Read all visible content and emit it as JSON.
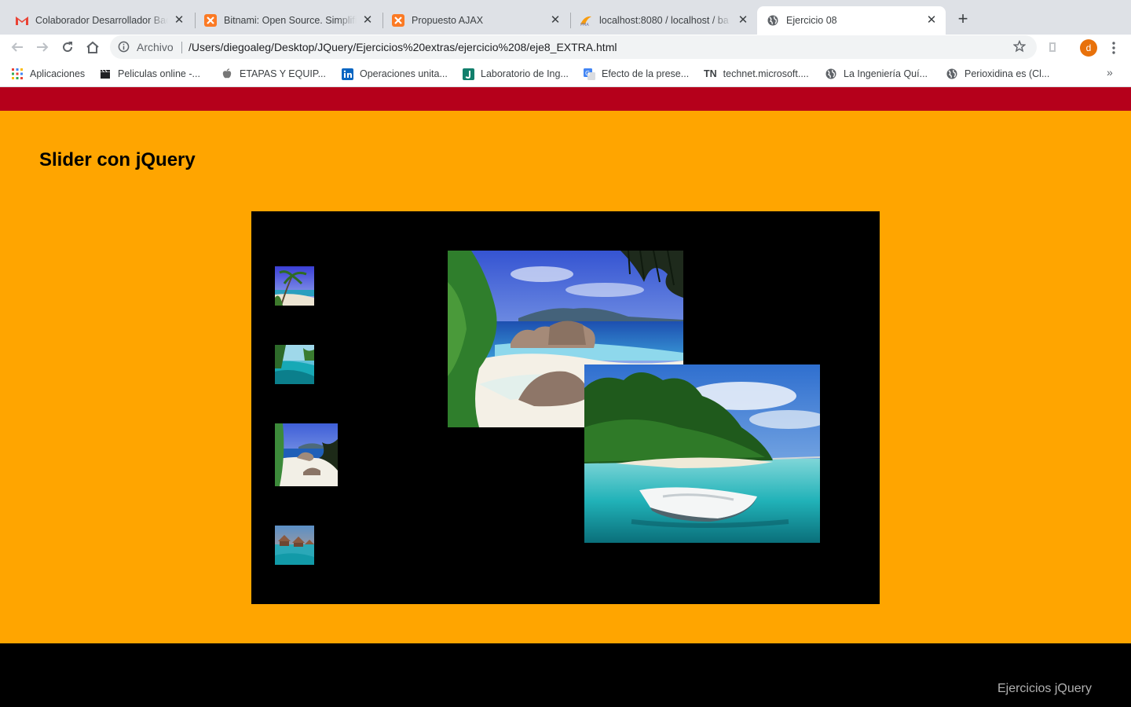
{
  "browser": {
    "tabs": [
      {
        "title": "Colaborador Desarrollador Bac",
        "icon": "gmail-icon",
        "active": false
      },
      {
        "title": "Bitnami: Open Source. Simplifie",
        "icon": "xampp-icon",
        "active": false
      },
      {
        "title": "Propuesto AJAX",
        "icon": "xampp-icon",
        "active": false
      },
      {
        "title": "localhost:8080 / localhost / ba",
        "icon": "phpmyadmin-icon",
        "active": false
      },
      {
        "title": "Ejercicio 08",
        "icon": "globe-icon",
        "active": true
      }
    ],
    "address_bar": {
      "security_label": "Archivo",
      "url": "/Users/diegoaleg/Desktop/JQuery/Ejercicios%20extras/ejercicio%208/eje8_EXTRA.html"
    },
    "profile_initial": "d",
    "bookmarks": [
      {
        "label": "Aplicaciones",
        "icon": "apps-grid-icon"
      },
      {
        "label": "Peliculas online -...",
        "icon": "clapper-icon"
      },
      {
        "label": "ETAPAS Y EQUIP...",
        "icon": "apple-icon"
      },
      {
        "label": "Operaciones unita...",
        "icon": "linkedin-icon"
      },
      {
        "label": "Laboratorio de Ing...",
        "icon": "j-icon"
      },
      {
        "label": "Efecto de la prese...",
        "icon": "translate-icon"
      },
      {
        "label": "technet.microsoft....",
        "icon": "tn-icon",
        "prefix": "TN"
      },
      {
        "label": "La Ingeniería Quí...",
        "icon": "globe-icon"
      },
      {
        "label": "Perioxidina es (Cl...",
        "icon": "globe-icon"
      }
    ]
  },
  "page": {
    "title": "Slider con jQuery",
    "footer_text": "Ejercicios jQuery",
    "colors": {
      "top_bar": "#b5001b",
      "main_background": "#ffa500",
      "slider_background": "#000000",
      "footer_background": "#000000"
    },
    "thumbnails": [
      {
        "image": "palm-beach"
      },
      {
        "image": "lagoon-pool"
      },
      {
        "image": "seychelles-beach"
      },
      {
        "image": "overwater-bungalows"
      }
    ],
    "slides": [
      {
        "image": "seychelles-beach"
      },
      {
        "image": "tropical-boat"
      }
    ]
  }
}
